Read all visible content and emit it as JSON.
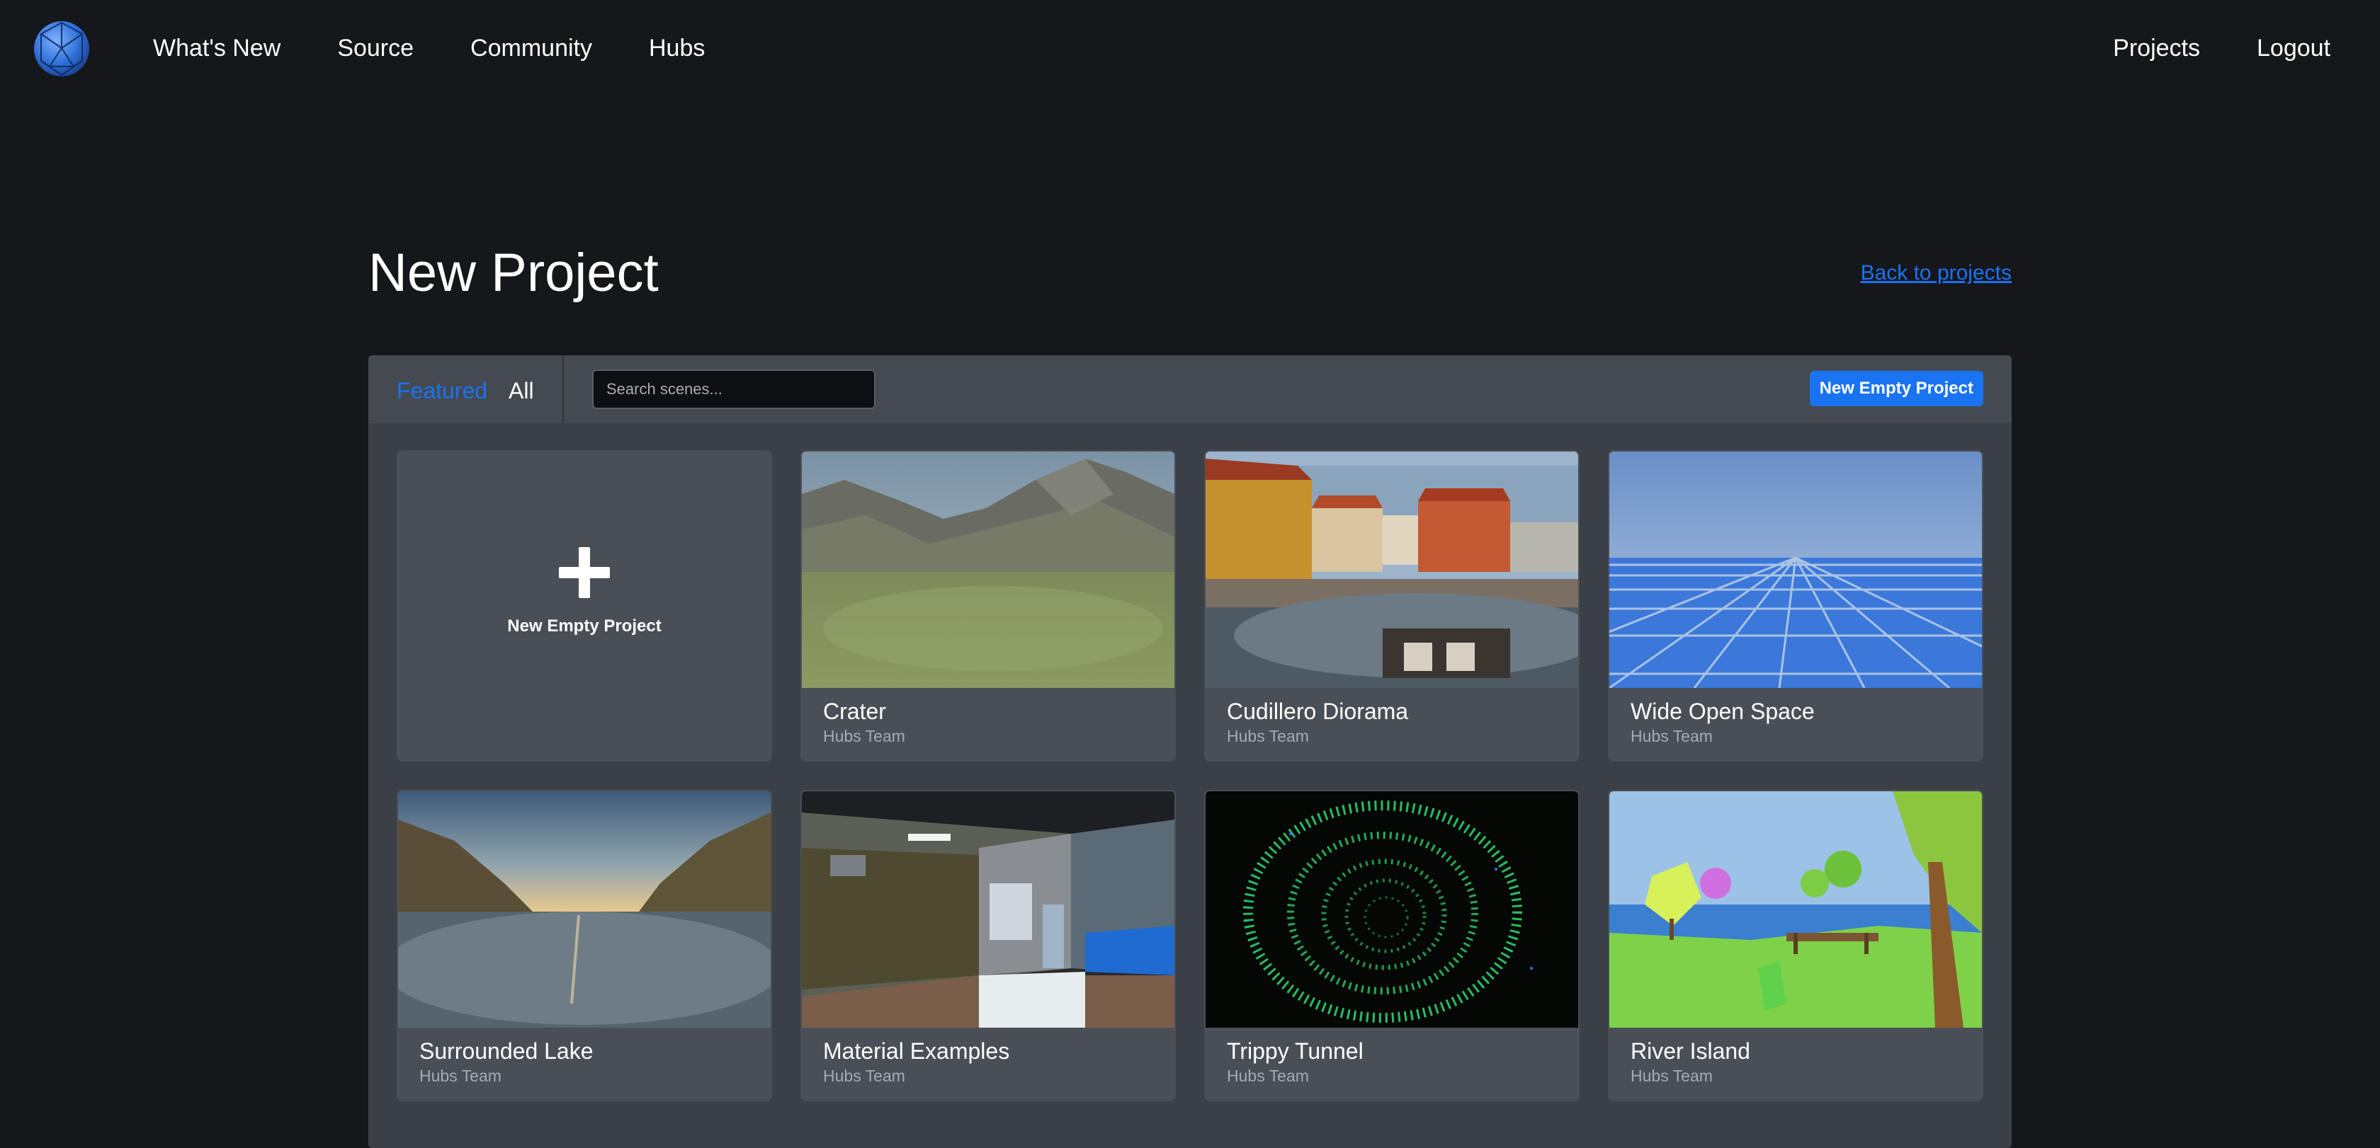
{
  "nav": {
    "logo_icon": "spoke-globe-logo-icon",
    "left_links": [
      {
        "label": "What's New"
      },
      {
        "label": "Source"
      },
      {
        "label": "Community"
      },
      {
        "label": "Hubs"
      }
    ],
    "right_links": [
      {
        "label": "Projects"
      },
      {
        "label": "Logout"
      }
    ]
  },
  "page": {
    "title": "New Project",
    "back_link": "Back to projects"
  },
  "toolbar": {
    "tabs": [
      {
        "label": "Featured",
        "active": true
      },
      {
        "label": "All",
        "active": false
      }
    ],
    "search_placeholder": "Search scenes...",
    "search_value": "",
    "new_empty_button": "New Empty Project"
  },
  "empty_card": {
    "icon": "plus-icon",
    "label": "New Empty Project"
  },
  "scenes": [
    {
      "title": "Crater",
      "author": "Hubs Team"
    },
    {
      "title": "Cudillero Diorama",
      "author": "Hubs Team"
    },
    {
      "title": "Wide Open Space",
      "author": "Hubs Team"
    },
    {
      "title": "Surrounded Lake",
      "author": "Hubs Team"
    },
    {
      "title": "Material Examples",
      "author": "Hubs Team"
    },
    {
      "title": "Trippy Tunnel",
      "author": "Hubs Team"
    },
    {
      "title": "River Island",
      "author": "Hubs Team"
    }
  ],
  "colors": {
    "background": "#16171b",
    "panel": "#3b3f46",
    "toolbar": "#454a51",
    "card": "#4a4f57",
    "accent": "#1a73f1"
  }
}
